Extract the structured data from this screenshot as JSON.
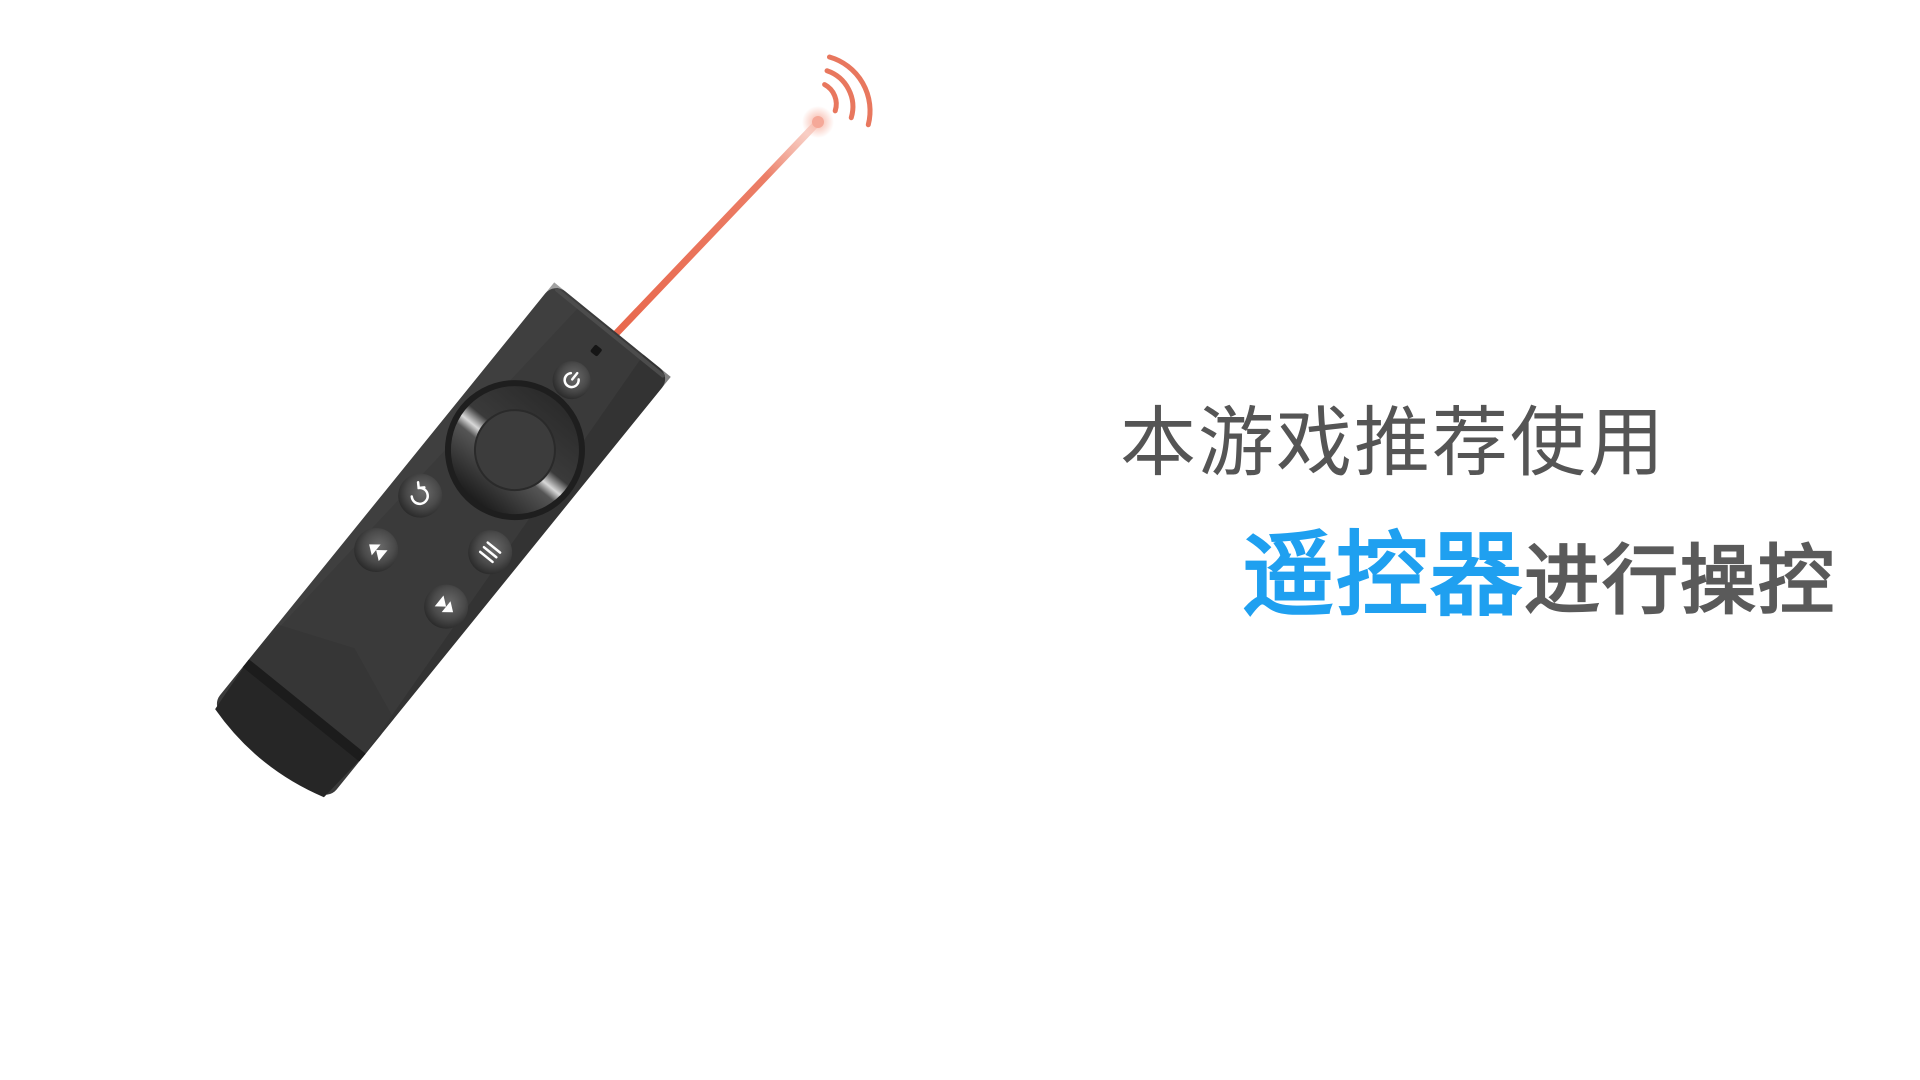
{
  "tip": {
    "line1": "本游戏推荐使用",
    "line2_highlight": "遥控器",
    "line2_rest": "进行操控"
  },
  "colors": {
    "background": "#ffffff",
    "highlight": "#1fa0f0",
    "text": "#555555",
    "laser": "#e8674c",
    "remote_body": "#3a3a3a"
  },
  "icons": {
    "remote": "tv-remote-illustration",
    "signal": "wifi-signal-icon",
    "power": "power-icon",
    "back": "back-icon",
    "menu": "menu-icon",
    "rewind": "rewind-icon",
    "fast_forward": "fast-forward-icon"
  }
}
